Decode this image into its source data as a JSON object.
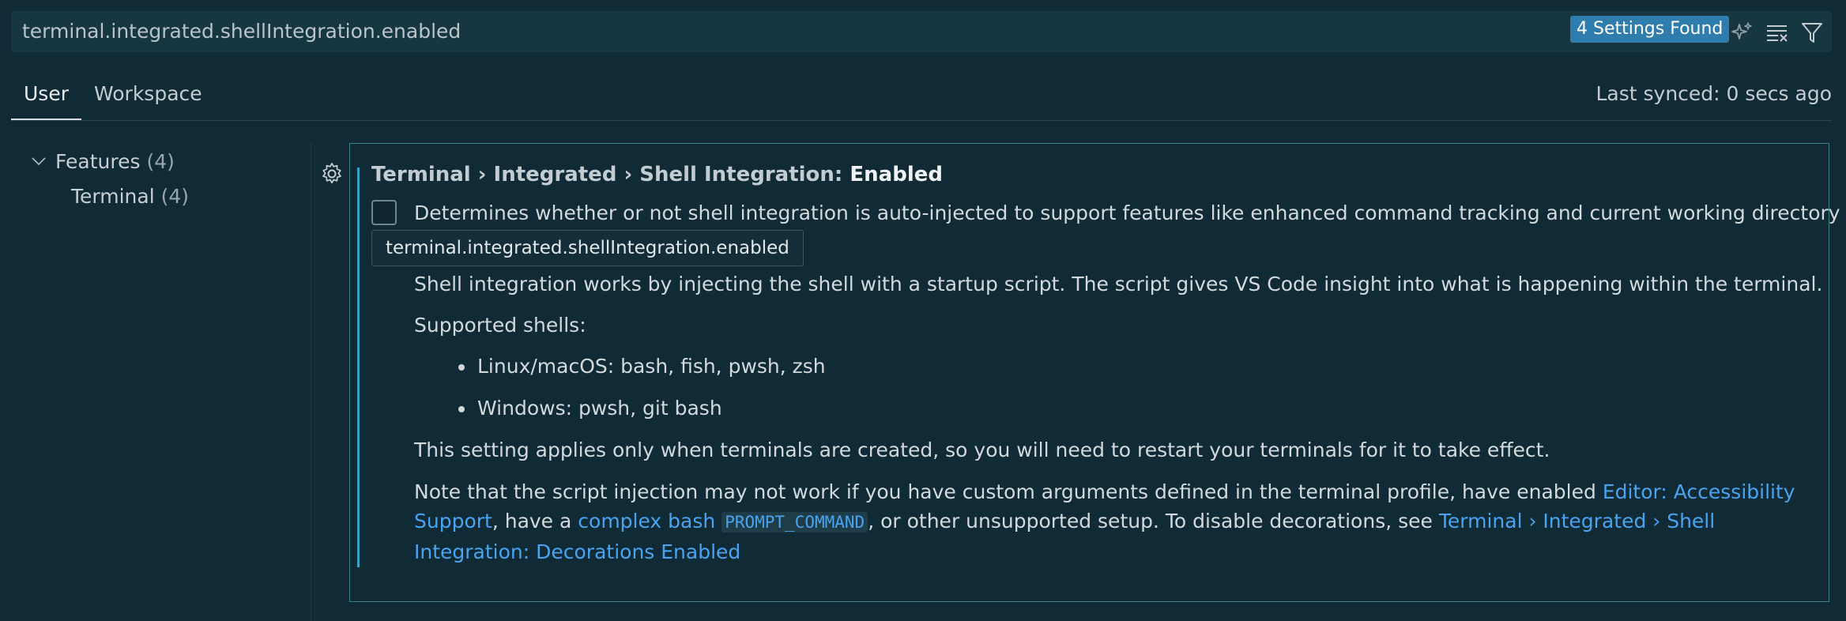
{
  "search": {
    "value": "terminal.integrated.shellIntegration.enabled",
    "result_count": "4 Settings Found",
    "actions": [
      {
        "icon": "sparkle-icon"
      },
      {
        "icon": "clear-filter-icon"
      },
      {
        "icon": "filter-icon"
      }
    ]
  },
  "tabs": [
    {
      "label": "User",
      "active": true
    },
    {
      "label": "Workspace",
      "active": false
    }
  ],
  "sync_status": "Last synced: 0 secs ago",
  "toc": {
    "group": {
      "label": "Features",
      "count": "(4)"
    },
    "item": {
      "label": "Terminal",
      "count": "(4)"
    }
  },
  "setting": {
    "title_prefix": "Terminal › Integrated › Shell Integration: ",
    "title_leaf": "Enabled",
    "checked": false,
    "key_tooltip": "terminal.integrated.shellIntegration.enabled",
    "description_line1": "Determines whether or not shell integration is auto-injected to support features like enhanced command tracking and current working directory",
    "description_line2": "Shell integration works by injecting the shell with a startup script. The script gives VS Code insight into what is happening within the terminal.",
    "supported_label": "Supported shells:",
    "shells": [
      "Linux/macOS: bash, fish, pwsh, zsh",
      "Windows: pwsh, git bash"
    ],
    "restart_note": "This setting applies only when terminals are created, so you will need to restart your terminals for it to take effect.",
    "note": {
      "part1": "Note that the script injection may not work if you have custom arguments defined in the terminal profile, have enabled ",
      "link1": "Editor: Accessibility Support",
      "part2": ", have a ",
      "link2": "complex bash",
      "code": "PROMPT_COMMAND",
      "part3": ", or other unsupported setup. To disable decorations, see ",
      "link3": "Terminal › Integrated › Shell Integration: Decorations Enabled"
    }
  },
  "colors": {
    "background": "#112b36",
    "accent": "#36a3c3",
    "link": "#4aa3ef",
    "badge": "#2f7dad"
  }
}
